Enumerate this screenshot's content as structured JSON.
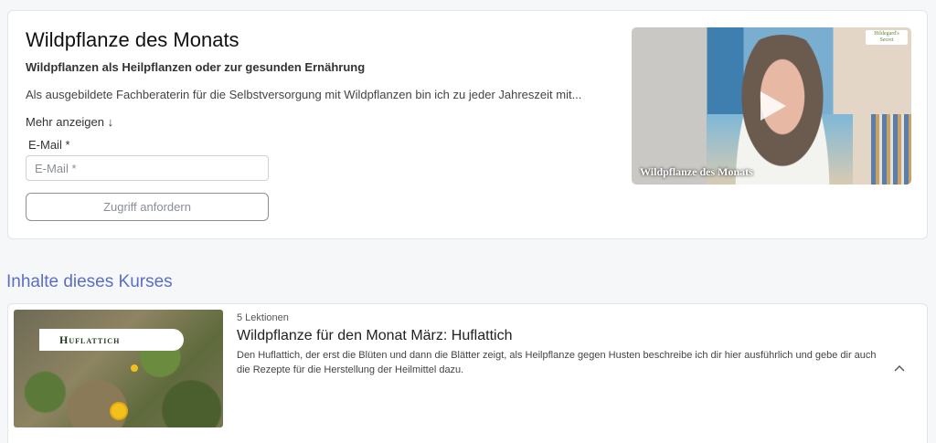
{
  "course": {
    "title": "Wildpflanze des Monats",
    "subtitle": "Wildpflanzen als Heilpflanzen oder zur gesunden Ernährung",
    "description": "Als ausgebildete Fachberaterin für die Selbstversorgung mit Wildpflanzen bin ich zu jeder Jahreszeit mit...",
    "more_label": "Mehr anzeigen ↓"
  },
  "form": {
    "email_label": "E-Mail *",
    "email_placeholder": "E-Mail *",
    "email_value": "",
    "submit_label": "Zugriff anfordern"
  },
  "video": {
    "caption": "Wildpflanze des Monats",
    "logo_line1": "Hildegard's",
    "logo_line2": "Secret",
    "play_icon": "play-icon"
  },
  "section": {
    "title": "Inhalte dieses Kurses"
  },
  "lesson": {
    "thumb_label": "Huflattich",
    "count": "5  Lektionen",
    "title": "Wildpflanze für den Monat März: Huflattich",
    "description": "Den Huflattich, der erst die Blüten und dann die Blätter zeigt, als Heilpflanze gegen Husten beschreibe ich dir hier ausführlich und gebe dir auch die Rezepte für die Herstellung der Heilmittel dazu.",
    "toggle_icon": "chevron-up-icon"
  },
  "colors": {
    "accent": "#5b6ec2",
    "background": "#f6f7f9"
  }
}
